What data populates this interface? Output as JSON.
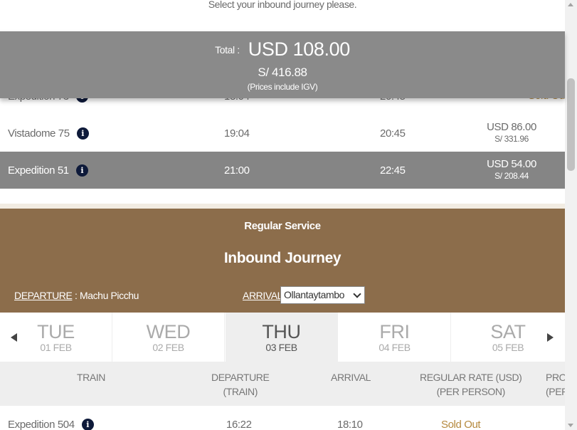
{
  "top_hint": "Select your inbound journey please.",
  "total": {
    "label": "Total :",
    "usd": "USD 108.00",
    "pen": "S/ 416.88",
    "note": "(Prices include IGV)"
  },
  "outbound_rows": [
    {
      "name": "Expedition 73",
      "dep": "18:04",
      "arr": "20:45",
      "price_usd": "Sold Out",
      "price_pen": "",
      "selected": false
    },
    {
      "name": "Vistadome 75",
      "dep": "19:04",
      "arr": "20:45",
      "price_usd": "USD 86.00",
      "price_pen": "S/ 331.96",
      "selected": false
    },
    {
      "name": "Expedition 51",
      "dep": "21:00",
      "arr": "22:45",
      "price_usd": "USD 54.00",
      "price_pen": "S/ 208.44",
      "selected": true
    }
  ],
  "service": {
    "title": "Regular Service",
    "journey": "Inbound Journey",
    "departure_label": "DEPARTURE",
    "departure_value": "Machu Picchu",
    "arrival_label": "ARRIVAL",
    "arrival_value": "Ollantaytambo"
  },
  "days": [
    {
      "name": "TUE",
      "date": "01 FEB",
      "active": false
    },
    {
      "name": "WED",
      "date": "02 FEB",
      "active": false
    },
    {
      "name": "THU",
      "date": "03 FEB",
      "active": true
    },
    {
      "name": "FRI",
      "date": "04 FEB",
      "active": false
    },
    {
      "name": "SAT",
      "date": "05 FEB",
      "active": false
    }
  ],
  "table_headers": {
    "train": "TRAIN",
    "departure_1": "DEPARTURE",
    "departure_2": "(TRAIN)",
    "arrival": "ARRIVAL",
    "regular_1": "REGULAR RATE (USD)",
    "regular_2": "(PER PERSON)",
    "promo_1": "PRO",
    "promo_2": "(PER"
  },
  "inbound_rows": [
    {
      "name": "Expedition 504",
      "dep": "16:22",
      "arr": "18:10",
      "price": "Sold Out"
    }
  ],
  "colors": {
    "total_bar": "#8a8a8a",
    "service_brown": "#8c6d4b",
    "sold_out": "#b5893d",
    "info_icon": "#0e1a3a"
  }
}
